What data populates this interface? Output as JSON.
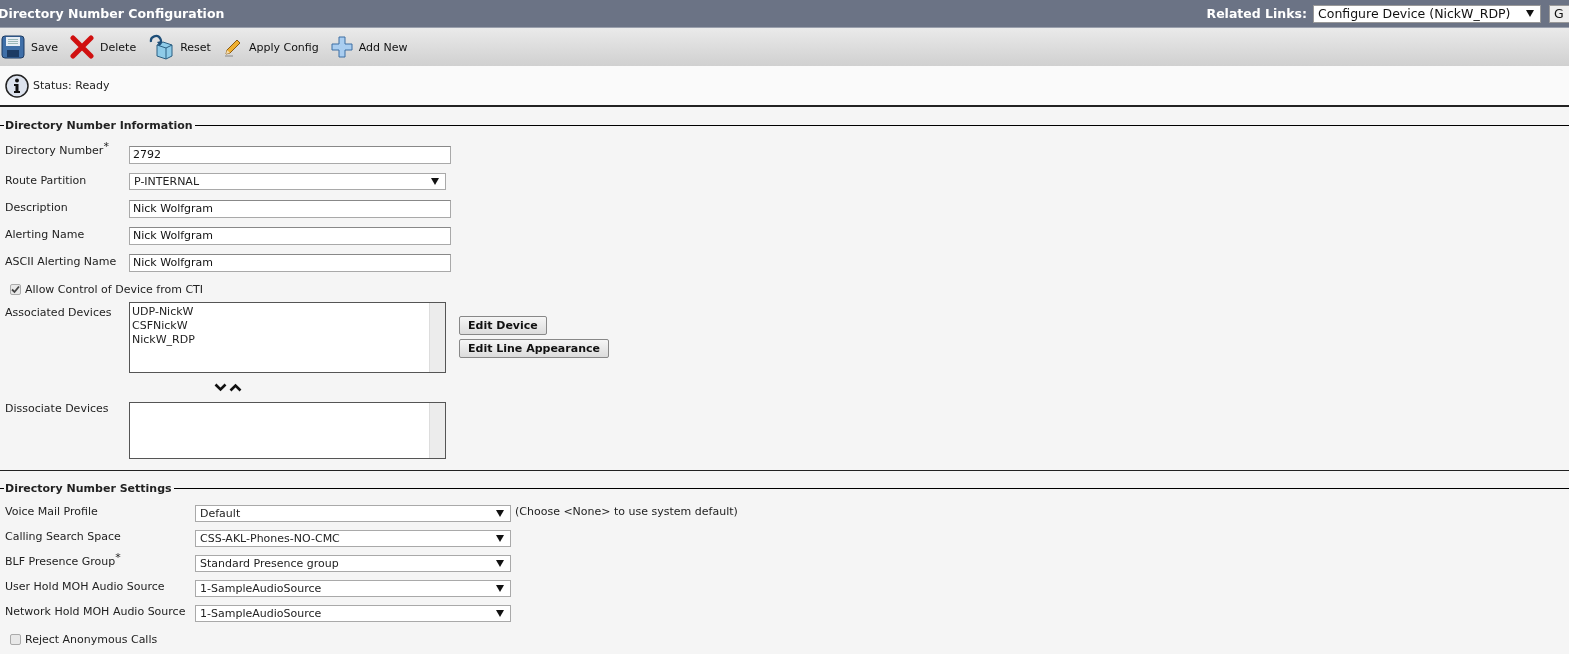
{
  "header": {
    "title": "Directory Number Configuration",
    "related_links_label": "Related Links:",
    "related_links_value": "Configure Device (NickW_RDP)",
    "go_button": "G"
  },
  "toolbar": [
    {
      "kind": "save",
      "label": "Save"
    },
    {
      "kind": "delete",
      "label": "Delete"
    },
    {
      "kind": "reset",
      "label": "Reset"
    },
    {
      "kind": "apply",
      "label": "Apply Config"
    },
    {
      "kind": "add",
      "label": "Add New"
    }
  ],
  "status": "Status: Ready",
  "directory_number_information": {
    "legend": "Directory Number Information",
    "fields": [
      {
        "kind": "text",
        "label": "Directory Number$^{*}$",
        "value": "2792"
      },
      {
        "kind": "select",
        "label": "Route Partition",
        "value": "P-INTERNAL"
      },
      {
        "kind": "text",
        "label": "Description",
        "value": "Nick Wolfgram"
      },
      {
        "kind": "text",
        "label": "Alerting Name",
        "value": "Nick Wolfgram"
      },
      {
        "kind": "text",
        "label": "ASCII Alerting Name",
        "value": "Nick Wolfgram"
      }
    ],
    "allow_cti": {
      "label": "Allow Control of Device from CTI",
      "checked": true
    },
    "associated_devices": {
      "label": "Associated Devices",
      "items": [
        "UDP-NickW",
        "CSFNickW",
        "NickW_RDP"
      ]
    },
    "buttons": [
      "Edit Device",
      "Edit Line Appearance"
    ],
    "dissociate_devices": {
      "label": "Dissociate Devices"
    }
  },
  "directory_number_settings": {
    "legend": "Directory Number Settings",
    "fields": [
      {
        "kind": "select",
        "label": "Voice Mail Profile",
        "value": "Default",
        "note": "(Choose <None> to use system default)"
      },
      {
        "kind": "select",
        "label": "Calling Search Space",
        "value": "CSS-AKL-Phones-NO-CMC"
      },
      {
        "kind": "select",
        "label": "BLF Presence Group$^{*}$",
        "value": "Standard Presence group"
      },
      {
        "kind": "select",
        "label": "User Hold MOH Audio Source",
        "value": "1-SampleAudioSource"
      },
      {
        "kind": "select",
        "label": "Network Hold MOH Audio Source",
        "value": "1-SampleAudioSource"
      }
    ],
    "reject_anonymous": {
      "label": "Reject Anonymous Calls",
      "checked": false
    }
  }
}
